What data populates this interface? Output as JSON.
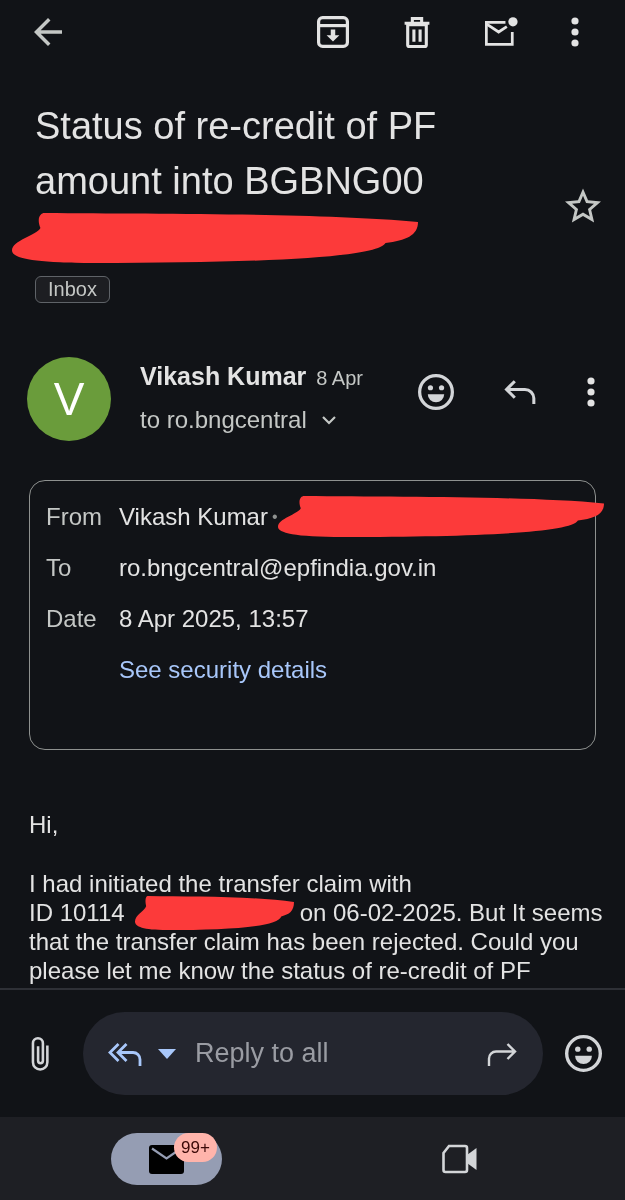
{
  "subject": {
    "title": "Status of re-credit of PF amount into BGBNG00",
    "redacted": true,
    "starred": false
  },
  "labels": [
    {
      "label": "Inbox"
    }
  ],
  "message": {
    "sender": {
      "initial": "V",
      "name": "Vikash Kumar"
    },
    "date": "8 Apr",
    "recipient_summary": "to ro.bngcentral",
    "details": {
      "rows": [
        {
          "label": "From",
          "value": "Vikash Kumar",
          "separator": "•",
          "redacted": true
        },
        {
          "label": "To",
          "value": "ro.bngcentral@epfindia.gov.in",
          "redacted": false
        },
        {
          "label": "Date",
          "value": "8 Apr 2025, 13:57",
          "redacted": false
        }
      ],
      "link": "See security details"
    },
    "body": {
      "greeting": "Hi,",
      "lines": [
        {
          "kind": "text",
          "text": "I had initiated the transfer claim with"
        },
        {
          "kind": "redacted",
          "before": "ID 10114",
          "after": "on 06-02-2025. But It seems"
        },
        {
          "kind": "text",
          "text": "that the transfer claim has been rejected. Could you"
        },
        {
          "kind": "text",
          "text": "please let me know the status of re-credit of PF"
        }
      ]
    }
  },
  "reply_bar": {
    "placeholder": "Reply to all"
  },
  "bottom_nav": {
    "tabs": [
      {
        "kind": "mail",
        "selected": true,
        "badge": "99+"
      },
      {
        "kind": "meet",
        "selected": false
      }
    ]
  }
}
